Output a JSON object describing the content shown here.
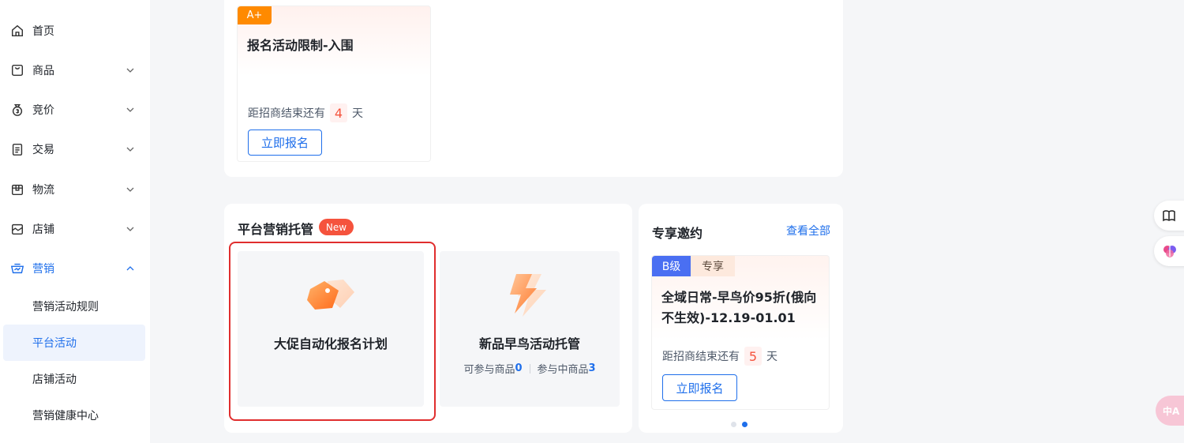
{
  "sidebar": {
    "items": [
      {
        "label": "首页",
        "icon": "home-icon",
        "has_chevron": false
      },
      {
        "label": "商品",
        "icon": "bag-icon",
        "has_chevron": true
      },
      {
        "label": "竞价",
        "icon": "money-bag-icon",
        "has_chevron": true
      },
      {
        "label": "交易",
        "icon": "clipboard-icon",
        "has_chevron": true
      },
      {
        "label": "物流",
        "icon": "box-icon",
        "has_chevron": true
      },
      {
        "label": "店铺",
        "icon": "store-icon",
        "has_chevron": true
      },
      {
        "label": "营销",
        "icon": "marketing-icon",
        "has_chevron": true,
        "expanded": true,
        "active": true
      }
    ],
    "sub_items": [
      {
        "label": "营销活动规则"
      },
      {
        "label": "平台活动",
        "selected": true
      },
      {
        "label": "店铺活动"
      },
      {
        "label": "营销健康中心"
      }
    ]
  },
  "top_activity": {
    "grade": "A+",
    "title": "报名活动限制-入围",
    "countdown_prefix": "距招商结束还有",
    "countdown_days": "4",
    "countdown_suffix": "天",
    "button_label": "立即报名"
  },
  "platform_management": {
    "title": "平台营销托管",
    "badge": "New",
    "plans": [
      {
        "title": "大促自动化报名计划",
        "icon": "price-tag-icon"
      },
      {
        "title": "新品早鸟活动托管",
        "icon": "lightning-icon",
        "stats": {
          "available_label": "可参与商品",
          "available_value": "0",
          "joined_label": "参与中商品",
          "joined_value": "3"
        }
      }
    ]
  },
  "exclusive_invite": {
    "title": "专享邀约",
    "view_all_label": "查看全部",
    "card": {
      "grade": "B级",
      "tag": "专享",
      "title": "全域日常-早鸟价95折(俄向不生效)-12.19-01.01",
      "countdown_prefix": "距招商结束还有",
      "countdown_days": "5",
      "countdown_suffix": "天",
      "button_label": "立即报名"
    },
    "pagination": {
      "total": 2,
      "current": 2
    }
  },
  "floating": {
    "translate_label": "中A"
  },
  "colors": {
    "accent": "#1f6feb",
    "danger": "#f5533d",
    "grade_a": "#ff8a00",
    "grade_b": "#4a6ff2",
    "highlight": "#e02e2e"
  }
}
